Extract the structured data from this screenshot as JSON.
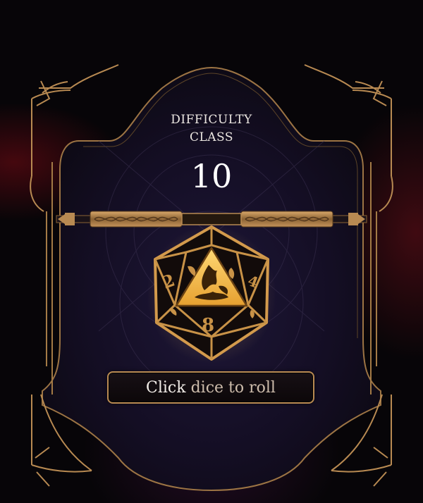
{
  "difficulty": {
    "label_line1": "DIFFICULTY",
    "label_line2": "CLASS",
    "value": "10"
  },
  "dice": {
    "icon": "d20-icon",
    "visible_faces": [
      "2",
      "8"
    ]
  },
  "roll_button": {
    "action": "Click",
    "rest": "dice to roll"
  },
  "colors": {
    "gold": "#b88a52",
    "gold_bright": "#f2c15a",
    "panel_fill": "#120c1e",
    "text": "#ece7e2",
    "background_red": "#78101a"
  }
}
